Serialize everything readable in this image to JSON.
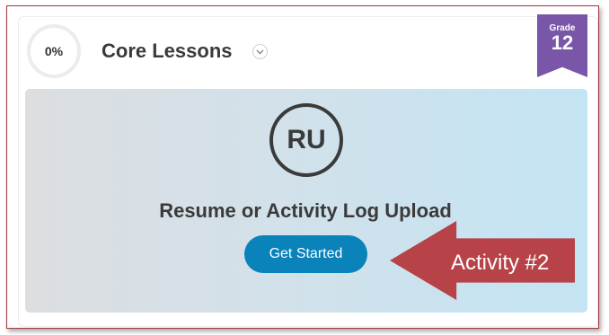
{
  "course": {
    "progress_text": "0%",
    "title": "Core Lessons",
    "grade_label": "Grade",
    "grade_value": "12"
  },
  "activity": {
    "initials": "RU",
    "title": "Resume or Activity Log Upload",
    "button_label": "Get Started"
  },
  "annotation": {
    "label": "Activity #2",
    "color": "#b74248"
  },
  "colors": {
    "button": "#0a82ba",
    "ribbon": "#7a56a8",
    "frame_border": "#a2383c"
  },
  "icons": {
    "dropdown": "chevron-down-icon"
  }
}
